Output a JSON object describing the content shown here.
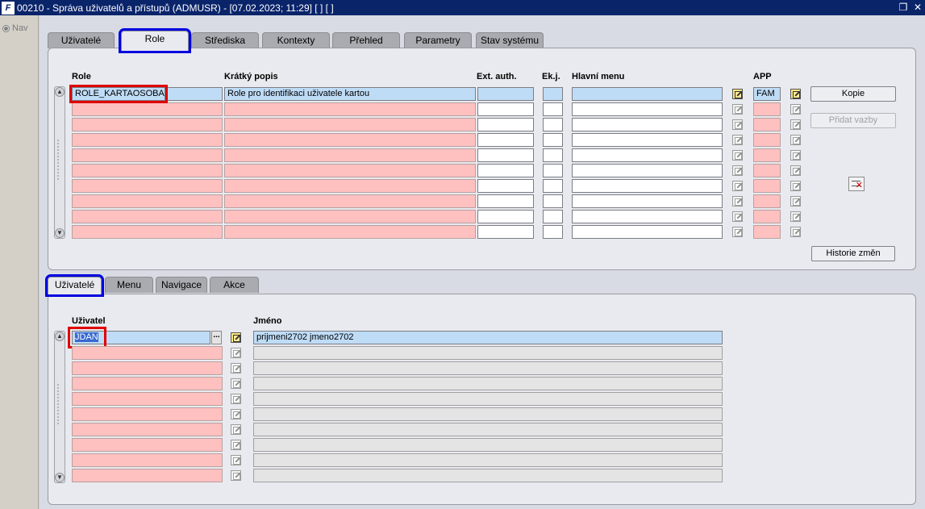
{
  "window": {
    "title": "00210 - Správa uživatelů a přístupů (ADMUSR) - [07.02.2023; 11:29]  [ ]  [ ]",
    "logo_text": "F"
  },
  "left_nav": {
    "label": "Nav"
  },
  "top_tabs": [
    {
      "label": "Uživatelé",
      "active": false
    },
    {
      "label": "Role",
      "active": true
    },
    {
      "label": "Střediska",
      "active": false
    },
    {
      "label": "Kontexty",
      "active": false
    },
    {
      "label": "Přehled",
      "active": false
    },
    {
      "label": "Parametry",
      "active": false
    },
    {
      "label": "Stav systému",
      "active": false
    }
  ],
  "role_table": {
    "headers": {
      "role": "Role",
      "short_desc": "Krátký popis",
      "ext_auth": "Ext. auth.",
      "ekj": "Ek.j.",
      "main_menu": "Hlavní menu",
      "app": "APP"
    },
    "rows": [
      {
        "role": "ROLE_KARTAOSOBA",
        "short_desc": "Role pro identifikaci uživatele kartou",
        "ext_auth": "",
        "ekj": "",
        "main_menu": "",
        "app": "FAM"
      },
      {
        "role": "",
        "short_desc": "",
        "ext_auth": "",
        "ekj": "",
        "main_menu": "",
        "app": ""
      },
      {
        "role": "",
        "short_desc": "",
        "ext_auth": "",
        "ekj": "",
        "main_menu": "",
        "app": ""
      },
      {
        "role": "",
        "short_desc": "",
        "ext_auth": "",
        "ekj": "",
        "main_menu": "",
        "app": ""
      },
      {
        "role": "",
        "short_desc": "",
        "ext_auth": "",
        "ekj": "",
        "main_menu": "",
        "app": ""
      },
      {
        "role": "",
        "short_desc": "",
        "ext_auth": "",
        "ekj": "",
        "main_menu": "",
        "app": ""
      },
      {
        "role": "",
        "short_desc": "",
        "ext_auth": "",
        "ekj": "",
        "main_menu": "",
        "app": ""
      },
      {
        "role": "",
        "short_desc": "",
        "ext_auth": "",
        "ekj": "",
        "main_menu": "",
        "app": ""
      },
      {
        "role": "",
        "short_desc": "",
        "ext_auth": "",
        "ekj": "",
        "main_menu": "",
        "app": ""
      },
      {
        "role": "",
        "short_desc": "",
        "ext_auth": "",
        "ekj": "",
        "main_menu": "",
        "app": ""
      }
    ]
  },
  "role_buttons": {
    "copy": "Kopie",
    "add_links": "Přidat vazby",
    "history": "Historie změn"
  },
  "bottom_tabs": [
    {
      "label": "Uživatelé",
      "active": true
    },
    {
      "label": "Menu",
      "active": false
    },
    {
      "label": "Navigace",
      "active": false
    },
    {
      "label": "Akce",
      "active": false
    }
  ],
  "user_table": {
    "headers": {
      "user": "Uživatel",
      "name": "Jméno"
    },
    "lov_label": "...",
    "rows": [
      {
        "user": "JDAN",
        "name": "prijmeni2702 jmeno2702"
      },
      {
        "user": "",
        "name": ""
      },
      {
        "user": "",
        "name": ""
      },
      {
        "user": "",
        "name": ""
      },
      {
        "user": "",
        "name": ""
      },
      {
        "user": "",
        "name": ""
      },
      {
        "user": "",
        "name": ""
      },
      {
        "user": "",
        "name": ""
      },
      {
        "user": "",
        "name": ""
      },
      {
        "user": "",
        "name": ""
      }
    ]
  },
  "icons": {
    "title_restore": "restore-icon",
    "title_close": "close-icon",
    "edit": "edit-note-icon",
    "delete": "delete-record-icon",
    "scroll_up": "arrow-up-icon",
    "scroll_down": "arrow-down-icon"
  },
  "colors": {
    "title_bar": "#0a246a",
    "required_field": "#ffc0c0",
    "current_record": "#bfdcf7",
    "panel": "#e9eaef",
    "highlight_blue": "#0000e0",
    "highlight_red": "#e00000"
  }
}
